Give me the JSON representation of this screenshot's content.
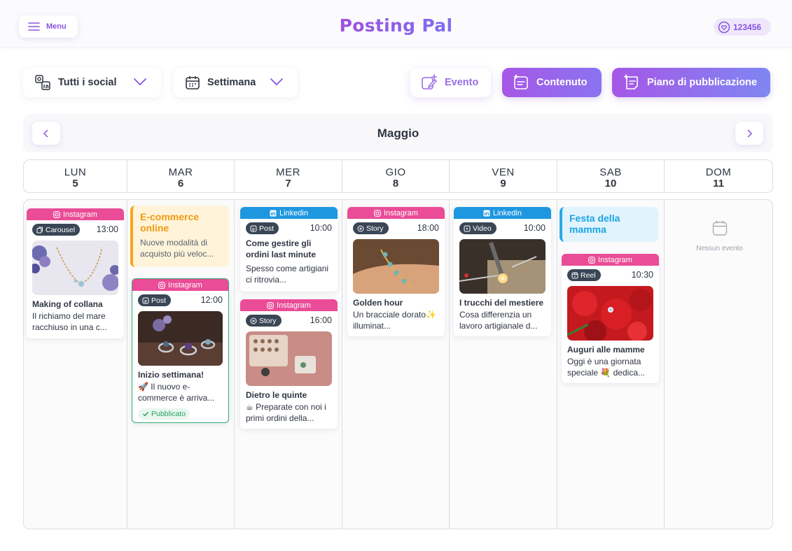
{
  "app": {
    "logo_text": "Posting Pal",
    "menu_label": "Menu",
    "credits": "123456",
    "brand_color": "#8c4fe2"
  },
  "filters": {
    "social_label": "Tutti i social",
    "period_label": "Settimana"
  },
  "actions": {
    "evento": "Evento",
    "contenuto": "Contenuto",
    "piano": "Piano di pubblicazione"
  },
  "calendar": {
    "month": "Maggio",
    "days": [
      {
        "name": "LUN",
        "date": "5"
      },
      {
        "name": "MAR",
        "date": "6"
      },
      {
        "name": "MER",
        "date": "7"
      },
      {
        "name": "GIO",
        "date": "8"
      },
      {
        "name": "VEN",
        "date": "9"
      },
      {
        "name": "SAB",
        "date": "10"
      },
      {
        "name": "DOM",
        "date": "11"
      }
    ],
    "empty_text": "Nessun evento"
  },
  "events": {
    "ecommerce": {
      "title": "E-commerce online",
      "desc": "Nuove modalità di acquisto più veloc..."
    },
    "festa": {
      "title": "Festa della mamma"
    }
  },
  "posts": {
    "collana": {
      "social": "Instagram",
      "type": "Carousel",
      "time": "13:00",
      "title": "Making of collana",
      "desc": "Il richiamo del mare racchiuso in una c..."
    },
    "inizio": {
      "social": "Instagram",
      "type": "Post",
      "time": "12:00",
      "title": "Inizio settimana!",
      "desc": "🚀 Il nuovo e-commerce è arriva...",
      "status": "Pubblicato"
    },
    "come": {
      "social": "Linkedin",
      "type": "Post",
      "time": "10:00",
      "title": "Come gestire gli ordini last minute",
      "desc": "Spesso come artigiani ci ritrovia..."
    },
    "quinte": {
      "social": "Instagram",
      "type": "Story",
      "time": "16:00",
      "title": "Dietro le quinte",
      "desc": "☕ Preparate con noi i primi ordini della..."
    },
    "golden": {
      "social": "Instagram",
      "type": "Story",
      "time": "18:00",
      "title": "Golden hour",
      "desc": "Un bracciale dorato✨ illuminat..."
    },
    "trucchi": {
      "social": "Linkedin",
      "type": "Video",
      "time": "10:00",
      "title": "I trucchi del mestiere",
      "desc": "Cosa differenzia un lavoro artigianale d..."
    },
    "auguri": {
      "social": "Instagram",
      "type": "Reel",
      "time": "10:30",
      "title": "Auguri alle mamme",
      "desc": "Oggi è una giornata speciale 💐 dedica..."
    }
  }
}
